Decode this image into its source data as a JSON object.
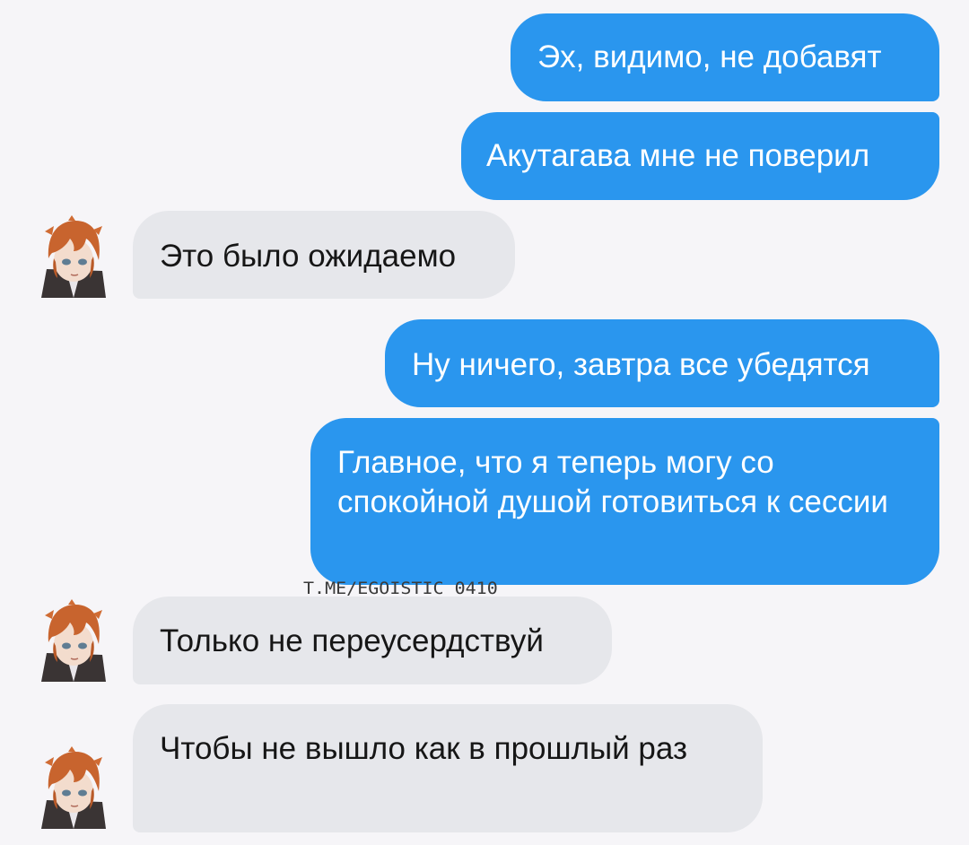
{
  "conversation": {
    "messages": [
      {
        "id": "m1",
        "direction": "outgoing",
        "text": "Эх, видимо, не добавят"
      },
      {
        "id": "m2",
        "direction": "outgoing",
        "text": "Акутагава мне не поверил"
      },
      {
        "id": "m3",
        "direction": "incoming",
        "text": "Это было ожидаемо"
      },
      {
        "id": "m4",
        "direction": "outgoing",
        "text": "Ну ничего, завтра все убедятся"
      },
      {
        "id": "m5",
        "direction": "outgoing",
        "text": "Главное, что я теперь могу со спокойной душой готовиться к сессии"
      },
      {
        "id": "m6",
        "direction": "incoming",
        "text": "Только не переусердствуй"
      },
      {
        "id": "m7",
        "direction": "incoming",
        "text": "Чтобы не вышло как в прошлый раз"
      }
    ],
    "avatar_icon": "anime-boy-avatar-icon"
  },
  "watermark": {
    "text": "T.ME/EGOISTIC_0410"
  },
  "colors": {
    "background": "#f6f5f8",
    "outgoing_bubble": "#2a96ee",
    "incoming_bubble": "#e6e7eb",
    "outgoing_text": "#ffffff",
    "incoming_text": "#161616"
  }
}
